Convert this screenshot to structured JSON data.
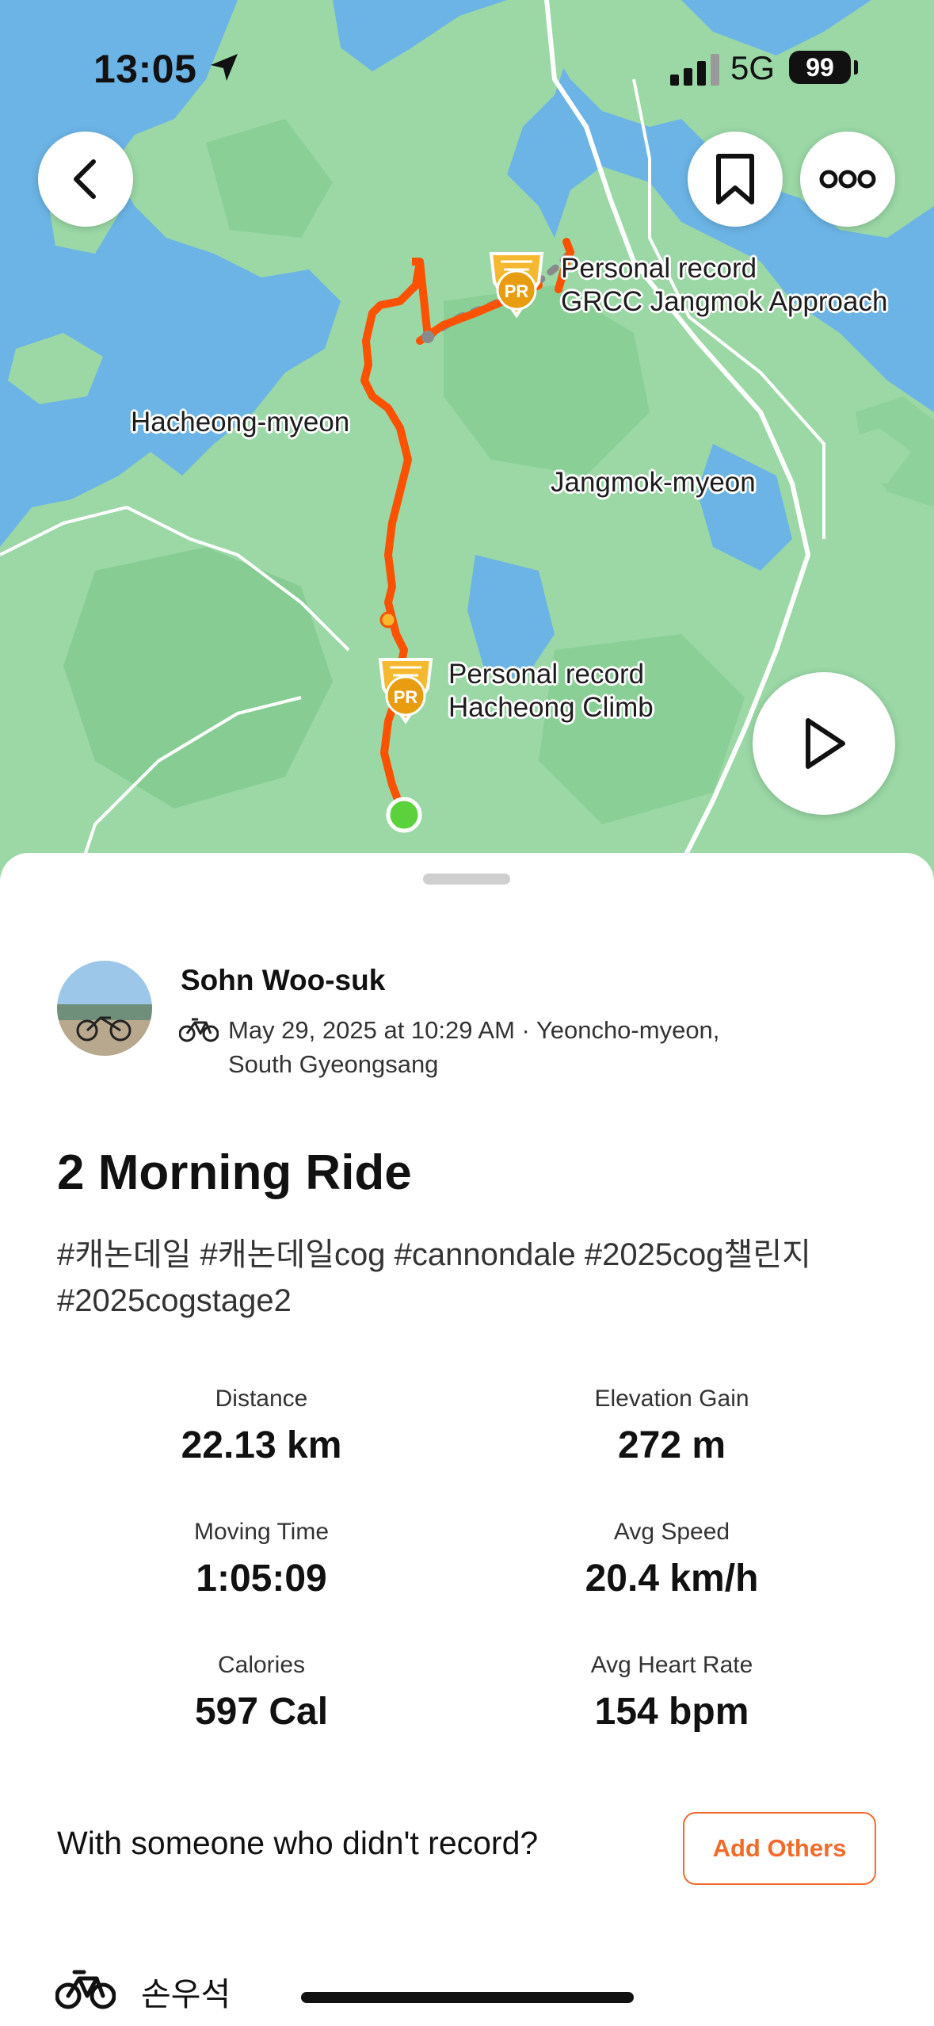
{
  "status_bar": {
    "time": "13:05",
    "network": "5G",
    "battery": "99"
  },
  "map": {
    "labels": {
      "hacheong": "Hacheong-myeon",
      "jangmok": "Jangmok-myeon"
    },
    "pr_markers": [
      {
        "badge": "PR",
        "title": "Personal record",
        "segment": "GRCC Jangmok Approach"
      },
      {
        "badge": "PR",
        "title": "Personal record",
        "segment": "Hacheong Climb"
      }
    ],
    "colors": {
      "water": "#6cb4e6",
      "land": "#9bd8a6",
      "route": "#fc5200",
      "start": "#5bd13c",
      "pr_badge": "#f5b82e"
    }
  },
  "athlete": {
    "name": "Sohn Woo-suk",
    "meta_line1": "May 29, 2025 at 10:29 AM · Yeoncho-myeon,",
    "meta_line2": "South Gyeongsang"
  },
  "activity": {
    "title": "2 Morning Ride",
    "description": "#캐논데일 #캐논데일cog #cannondale #2025cog챌린지 #2025cogstage2"
  },
  "stats": [
    {
      "label": "Distance",
      "value": "22.13 km"
    },
    {
      "label": "Elevation Gain",
      "value": "272 m"
    },
    {
      "label": "Moving Time",
      "value": "1:05:09"
    },
    {
      "label": "Avg Speed",
      "value": "20.4 km/h"
    },
    {
      "label": "Calories",
      "value": "597 Cal"
    },
    {
      "label": "Avg Heart Rate",
      "value": "154 bpm"
    }
  ],
  "with_others": {
    "prompt": "With someone who didn't record?",
    "button_label": "Add Others"
  },
  "gear": {
    "bike_name": "손우석"
  },
  "icons": {
    "back": "chevron-left-icon",
    "bookmark": "bookmark-icon",
    "more": "more-dots-icon",
    "play": "play-icon",
    "ride": "bicycle-icon"
  },
  "accent_color": "#f26b2b"
}
